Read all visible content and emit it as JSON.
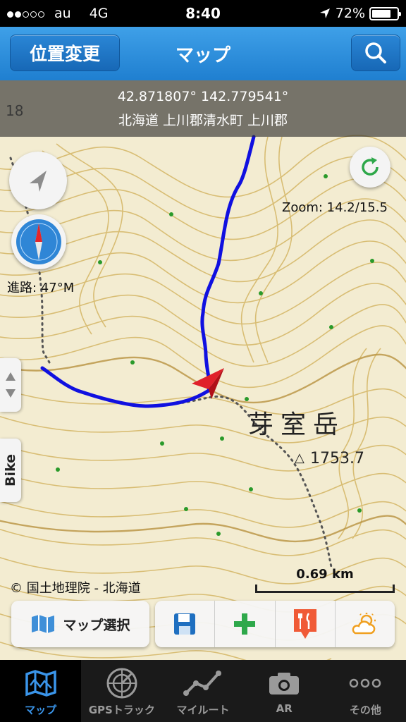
{
  "status_bar": {
    "carrier": "au",
    "network": "4G",
    "time": "8:40",
    "battery": "72%",
    "battery_level": 0.72,
    "signal_bars": 2
  },
  "nav": {
    "left_button": "位置変更",
    "title": "マップ",
    "right_icon": "search-icon"
  },
  "map": {
    "coords": "42.871807° 142.779541°",
    "address": "北海道 上川郡清水町 上川郡",
    "zoom": "Zoom: 14.2/15.5",
    "heading": "進路: 47°M",
    "mode_tab": "Bike",
    "copyright": "© 国土地理院 - 北海道",
    "scale": "0.69 km",
    "peak_name": "芽室岳",
    "peak_elevation": "1753.7",
    "colors": {
      "track": "#1010e0",
      "contour": "#d6b96a",
      "position_arrow": "#e0202a"
    }
  },
  "toolbar": {
    "map_select": "マップ選択",
    "icons": [
      "save-icon",
      "add-icon",
      "restaurant-icon",
      "weather-icon"
    ]
  },
  "tabs": [
    {
      "label": "マップ",
      "icon": "map-icon",
      "active": true
    },
    {
      "label": "GPSトラック",
      "icon": "radar-icon",
      "active": false
    },
    {
      "label": "マイルート",
      "icon": "route-icon",
      "active": false
    },
    {
      "label": "AR",
      "icon": "camera-icon",
      "active": false
    },
    {
      "label": "その他",
      "icon": "more-icon",
      "active": false
    }
  ]
}
